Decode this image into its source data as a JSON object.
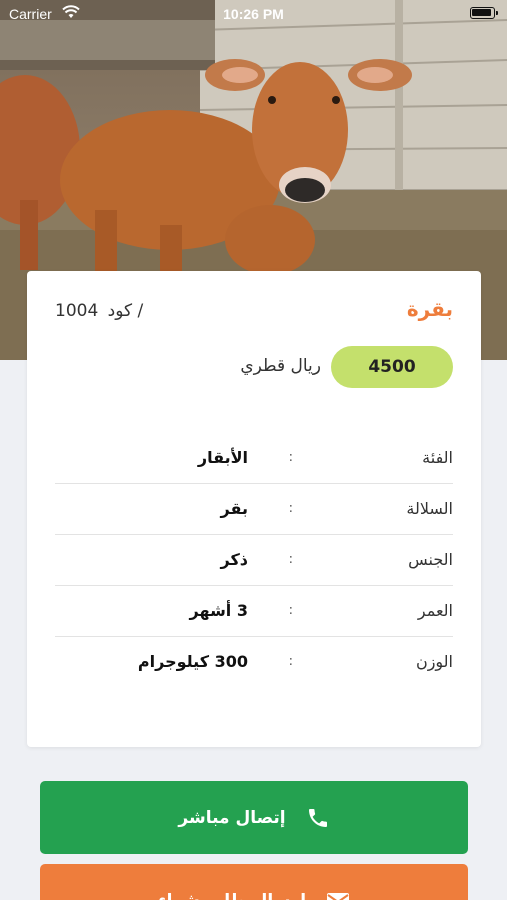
{
  "status_bar": {
    "carrier": "Carrier",
    "time": "10:26 PM"
  },
  "product": {
    "title": "بقرة",
    "code_label": "كود /",
    "code_value": "1004",
    "price": "4500",
    "currency": "ريال قطري"
  },
  "details": [
    {
      "label": "الفئة",
      "colon": ":",
      "value": "الأبقار"
    },
    {
      "label": "السلالة",
      "colon": ":",
      "value": "بقر"
    },
    {
      "label": "الجنس",
      "colon": ":",
      "value": "ذكر"
    },
    {
      "label": "العمر",
      "colon": ":",
      "value": "3 أشهر"
    },
    {
      "label": "الوزن",
      "colon": ":",
      "value": "300 كيلوجرام"
    }
  ],
  "actions": {
    "call_label": "إتصال مباشر",
    "buy_label": "إرسال طلب شراء"
  },
  "colors": {
    "accent_orange": "#ee7d3c",
    "price_green": "#c4e06c",
    "call_green": "#24a150"
  },
  "icons": {
    "call": "phone-icon",
    "buy": "envelope-icon",
    "wifi": "wifi-icon",
    "battery": "battery-icon"
  }
}
